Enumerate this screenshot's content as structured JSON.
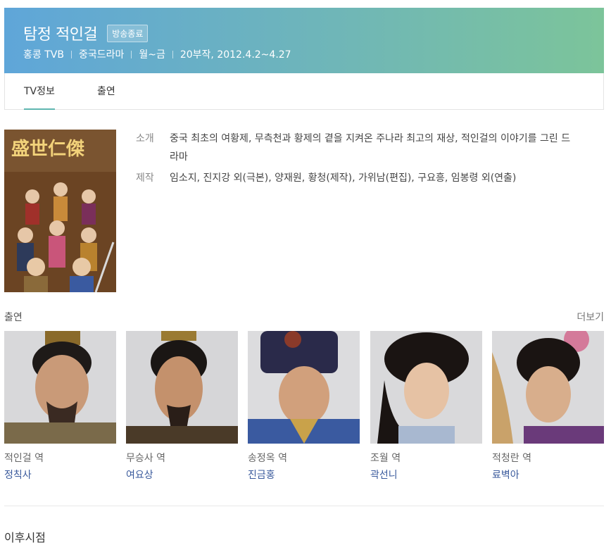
{
  "header": {
    "title": "탐정 적인걸",
    "badge": "방송종료",
    "meta": [
      "홍콩 TVB",
      "중국드라마",
      "월~금",
      "20부작, 2012.4.2~4.27"
    ]
  },
  "tabs": [
    {
      "label": "TV정보",
      "active": true
    },
    {
      "label": "출연",
      "active": false
    }
  ],
  "info": {
    "intro_label": "소개",
    "intro_text": "중국 최초의 여황제, 무측천과 황제의 곁을 지켜온 주나라 최고의 재상, 적인걸의 이야기를 그린 드라마",
    "production_label": "제작",
    "production_text": "임소지, 진지강 외(극본), 양재원, 황청(제작), 가위남(편집), 구요흥, 임봉령 외(연출)"
  },
  "cast_section": {
    "title": "출연",
    "more_label": "더보기",
    "items": [
      {
        "role": "적인걸 역",
        "actor": "정칙사"
      },
      {
        "role": "무승사 역",
        "actor": "여요상"
      },
      {
        "role": "송정옥 역",
        "actor": "진금홍"
      },
      {
        "role": "조월 역",
        "actor": "곽선니"
      },
      {
        "role": "적청란 역",
        "actor": "료벽아"
      }
    ]
  },
  "next_section": {
    "title": "이후시점"
  },
  "colors": {
    "accent": "#5fb6b0",
    "link": "#3a5a9c",
    "header_start": "#5fa6d9",
    "header_end": "#7cc49a"
  }
}
